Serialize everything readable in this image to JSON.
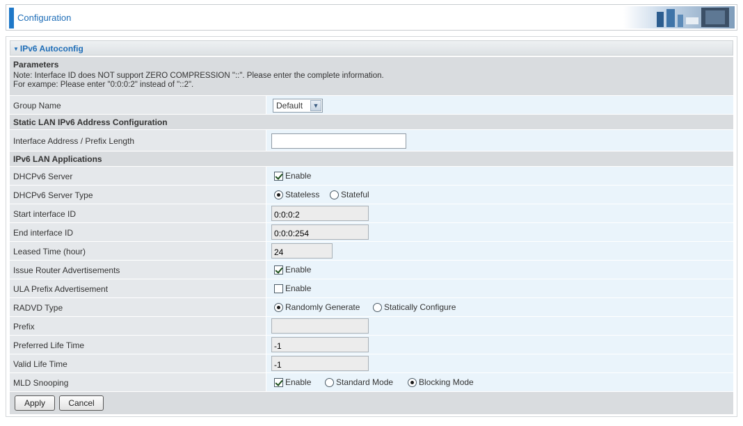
{
  "header": {
    "title": "Configuration"
  },
  "section": {
    "title": "IPv6 Autoconfig"
  },
  "parameters": {
    "heading": "Parameters",
    "note1": "Note: Interface ID does NOT support ZERO COMPRESSION \"::\". Please enter the complete information.",
    "note2": "For exampe: Please enter \"0:0:0:2\" instead of \"::2\"."
  },
  "group_name": {
    "label": "Group Name",
    "selected": "Default"
  },
  "static_lan": {
    "heading": "Static LAN IPv6 Address Configuration",
    "address_label": "Interface Address / Prefix Length",
    "address_value": ""
  },
  "applications": {
    "heading": "IPv6 LAN Applications",
    "dhcpv6_server": {
      "label": "DHCPv6 Server",
      "option": "Enable",
      "checked": true
    },
    "dhcpv6_type": {
      "label": "DHCPv6 Server Type",
      "options": [
        "Stateless",
        "Stateful"
      ],
      "selected": "Stateless"
    },
    "start_id": {
      "label": "Start interface ID",
      "value": "0:0:0:2"
    },
    "end_id": {
      "label": "End interface ID",
      "value": "0:0:0:254"
    },
    "leased_time": {
      "label": "Leased Time (hour)",
      "value": "24"
    },
    "issue_ra": {
      "label": "Issue Router Advertisements",
      "option": "Enable",
      "checked": true
    },
    "ula_prefix": {
      "label": "ULA Prefix Advertisement",
      "option": "Enable",
      "checked": false
    },
    "radvd_type": {
      "label": "RADVD Type",
      "options": [
        "Randomly Generate",
        "Statically Configure"
      ],
      "selected": "Randomly Generate"
    },
    "prefix": {
      "label": "Prefix",
      "value": ""
    },
    "preferred_life": {
      "label": "Preferred Life Time",
      "value": "-1"
    },
    "valid_life": {
      "label": "Valid Life Time",
      "value": "-1"
    },
    "mld_snooping": {
      "label": "MLD Snooping",
      "enable": "Enable",
      "checked": true,
      "modes": [
        "Standard Mode",
        "Blocking Mode"
      ],
      "selected": "Blocking Mode"
    }
  },
  "buttons": {
    "apply": "Apply",
    "cancel": "Cancel"
  },
  "colors": {
    "accent": "#1f78c8",
    "title_text": "#1f6eb8",
    "value_cell": "#eaf4fb",
    "label_cell": "#e5e8eb",
    "heading_cell": "#d9dcdf"
  }
}
